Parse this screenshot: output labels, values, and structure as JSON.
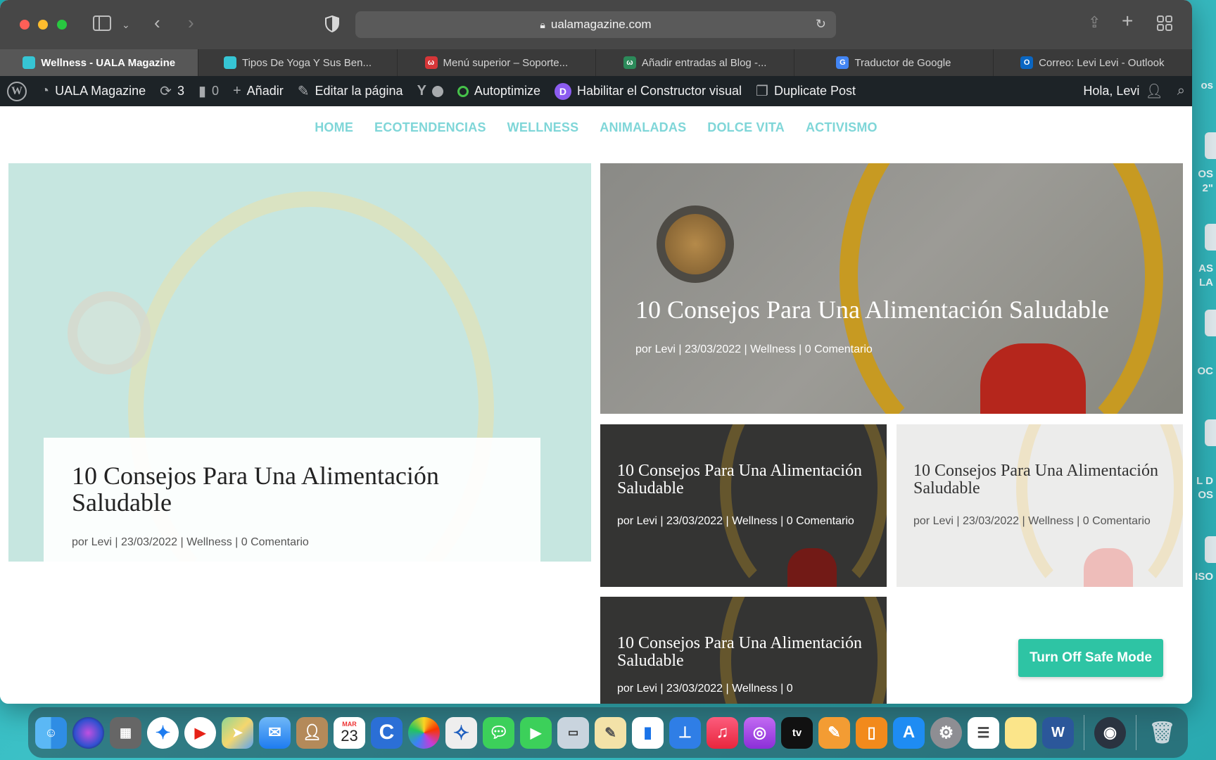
{
  "browser": {
    "url": "ualamagazine.com",
    "tabs": [
      {
        "label": "Wellness - UALA Magazine",
        "color": "#36c5d4",
        "glyph": "",
        "active": true
      },
      {
        "label": "Tipos De Yoga Y Sus Ben...",
        "color": "#36c5d4",
        "glyph": ""
      },
      {
        "label": "Menú superior – Soporte...",
        "color": "#d63638",
        "glyph": "ω"
      },
      {
        "label": "Añadir entradas al Blog -...",
        "color": "#2c8a5a",
        "glyph": "ω"
      },
      {
        "label": "Traductor de Google",
        "color": "#4285f4",
        "glyph": "G"
      },
      {
        "label": "Correo: Levi Levi - Outlook",
        "color": "#0a66c2",
        "glyph": "O"
      }
    ]
  },
  "adminbar": {
    "site": "UALA Magazine",
    "updates": "3",
    "comments": "0",
    "add": "Añadir",
    "edit": "Editar la página",
    "autoptimize": "Autoptimize",
    "builder": "Habilitar el Constructor visual",
    "duplicate": "Duplicate Post",
    "greeting": "Hola, Levi"
  },
  "nav": [
    "HOME",
    "ECOTENDENCIAS",
    "WELLNESS",
    "ANIMALADAS",
    "DOLCE VITA",
    "ACTIVISMO"
  ],
  "posts": {
    "big": {
      "title": "10 Consejos Para Una Alimentación Saludable",
      "meta": "por Levi | 23/03/2022 | Wellness | 0 Comentario"
    },
    "top_right": {
      "title": "10 Consejos Para Una Alimentación Saludable",
      "meta": "por Levi | 23/03/2022 | Wellness | 0 Comentario"
    },
    "mid_left": {
      "title": "10 Consejos Para Una Alimentación Saludable",
      "meta": "por Levi | 23/03/2022 | Wellness | 0 Comentario"
    },
    "mid_right": {
      "title": "10 Consejos Para Una Alimentación Saludable",
      "meta": "por Levi | 23/03/2022 | Wellness | 0 Comentario"
    },
    "bottom": {
      "title": "10 Consejos Para Una Alimentación Saludable",
      "meta": "por Levi | 23/03/2022 | Wellness | 0"
    }
  },
  "safe_mode_button": "Turn Off Safe Mode",
  "desktop_fragments": [
    "os",
    "OS",
    "2\"",
    "AS",
    "LA",
    "OC",
    "L D",
    "OS",
    "ISO"
  ],
  "dock": {
    "calendar_month": "MAR",
    "calendar_day": "23",
    "tv_label": "tv",
    "word_label": "W"
  }
}
